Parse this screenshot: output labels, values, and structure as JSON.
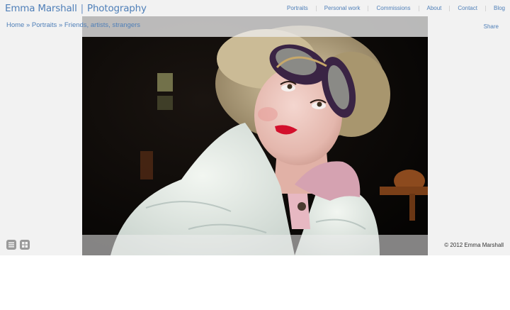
{
  "header": {
    "brand_name": "Emma Marshall",
    "brand_separator": "|",
    "brand_tagline": "Photography",
    "nav": [
      {
        "label": "Portraits"
      },
      {
        "label": "Personal work"
      },
      {
        "label": "Commissions"
      },
      {
        "label": "About"
      },
      {
        "label": "Contact"
      },
      {
        "label": "Blog"
      }
    ]
  },
  "breadcrumb": {
    "home": "Home",
    "sep1": "»",
    "section": "Portraits",
    "sep2": "»",
    "gallery": "Friends, artists, strangers"
  },
  "share_label": "Share",
  "footer": {
    "list_view_icon": "list-icon",
    "grid_view_icon": "grid-icon",
    "copyright": "© 2012 Emma Marshall"
  },
  "colors": {
    "link": "#4f7fb8",
    "page_background": "#f2f2f2",
    "view_button": "#9a9a9a"
  }
}
